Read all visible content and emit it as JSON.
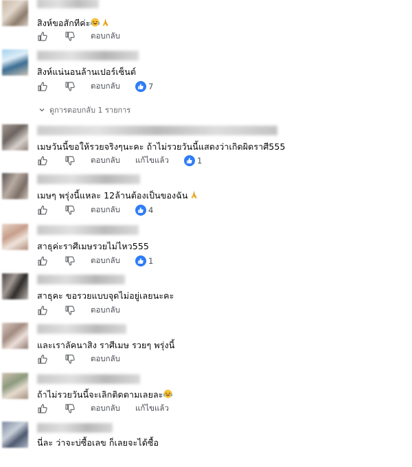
{
  "labels": {
    "reply": "ตอบกลับ",
    "edited": "แก้ไขแล้ว"
  },
  "view_replies": "ดูการตอบกลับ 1 รายการ",
  "comments": [
    {
      "text": "สิงห์ขอสักทีค่ะ",
      "emojis": [
        "laughing-crying",
        "praying-hands"
      ],
      "likes": null,
      "edited": false
    },
    {
      "text": "สิงห์แน่นอนล้านเปอร์เซ็นต์",
      "emojis": [],
      "likes": "7",
      "edited": false
    },
    {
      "text": "เมษวันนี้ขอให้รวยจริงๆนะคะ ถ้าไม่รวยวันนี้แสดงว่าเกิดผิดราศี555",
      "emojis": [],
      "likes": "1",
      "edited": true
    },
    {
      "text": "เมษๆ พรุ่งนี้แหละ 12ล้านต้องเป็นของฉัน",
      "emojis": [
        "praying-hands"
      ],
      "likes": "4",
      "edited": false
    },
    {
      "text": "สาธุค่ะราศีเมษรวยไม่ไหว555",
      "emojis": [],
      "likes": "1",
      "edited": false
    },
    {
      "text": "สาธุคะ ขอรวยแบบจุดไม่อยู่เลยนะคะ",
      "emojis": [],
      "likes": null,
      "edited": false
    },
    {
      "text": "และเราลัคนาสิง ราศีเมษ รวยๆ พรุ่งนี้",
      "emojis": [],
      "likes": null,
      "edited": false
    },
    {
      "text": "ถ้าไม่รวยวันนี้จะเลิกติดตามเลยละ",
      "emojis": [
        "laughing-crying"
      ],
      "likes": null,
      "edited": true
    },
    {
      "text": "นี่ละ ว่าจะบ่ซื้อเลข ก็เลยจะได้ซื้อ",
      "emojis": [],
      "likes": null,
      "edited": false
    }
  ],
  "colors": {
    "like_blue": "#2e7cf6",
    "secondary_text": "#4b4f56"
  }
}
